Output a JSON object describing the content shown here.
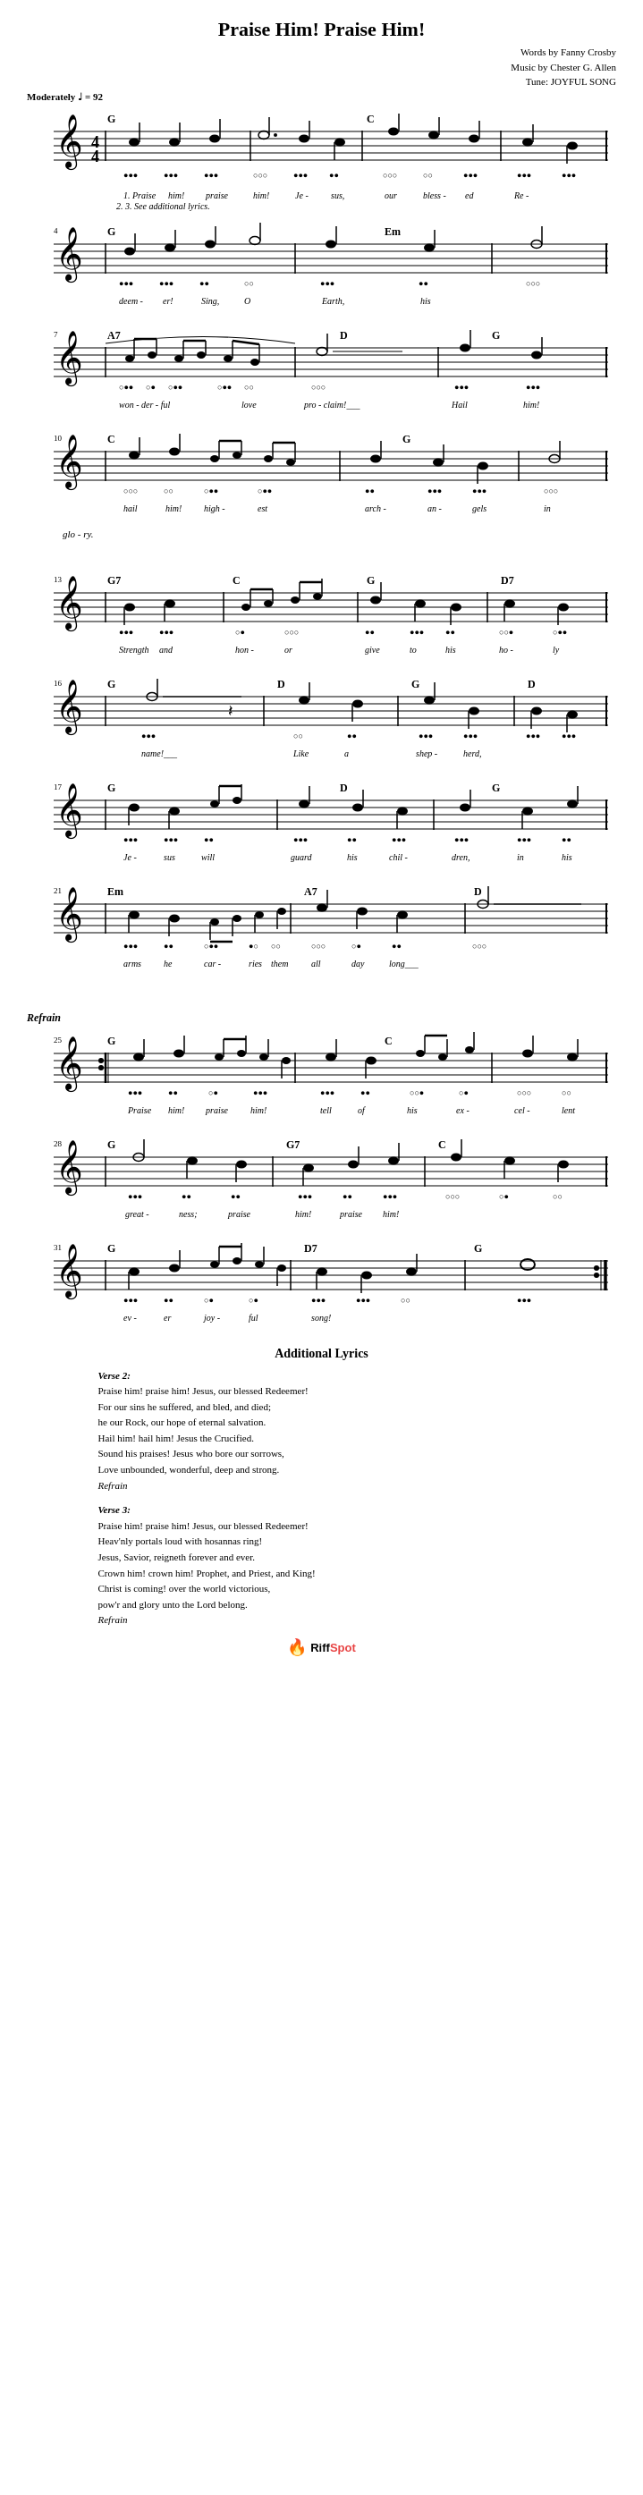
{
  "page": {
    "title": "Praise Him! Praise Him!",
    "credits": {
      "words": "Words by Fanny Crosby",
      "music": "Music by Chester G. Allen",
      "tune": "Tune: JOYFUL SONG"
    },
    "tempo": "Moderately",
    "bpm": "♩ = 92",
    "sections": [
      {
        "id": "verse1",
        "label": "",
        "measures": "1-3",
        "chords": [
          "G",
          "",
          "",
          "",
          "",
          "C",
          "",
          ""
        ],
        "lyrics": [
          "1. Praise",
          "him!",
          "praise",
          "him!",
          "Je -",
          "sus,",
          "our",
          "bless -",
          "ed",
          "Re -"
        ]
      }
    ],
    "additional_lyrics": {
      "title": "Additional Lyrics",
      "verses": [
        {
          "label": "Verse 2:",
          "lines": [
            "Praise him! praise him! Jesus, our blessed Redeemer!",
            "For our sins he suffered, and bled, and died;",
            "he our Rock, our hope of eternal salvation.",
            "Hail him! hail him! Jesus the Crucified.",
            "Sound his praises! Jesus who bore our sorrows,",
            "Love unbounded, wonderful, deep and strong.",
            "Refrain"
          ]
        },
        {
          "label": "Verse 3:",
          "lines": [
            "Praise him! praise him! Jesus, our blessed Redeemer!",
            "Heav'nly portals loud with hosannas ring!",
            "Jesus, Savior, reigneth forever and ever.",
            "Crown him! crown him! Prophet, and Priest, and King!",
            "Christ is coming! over the world victorious,",
            "pow'r and glory unto the Lord belong.",
            "Refrain"
          ]
        }
      ]
    },
    "watermark": {
      "text": "RiffSpot",
      "riff_part": "Riff",
      "spot_part": "Spot"
    }
  }
}
